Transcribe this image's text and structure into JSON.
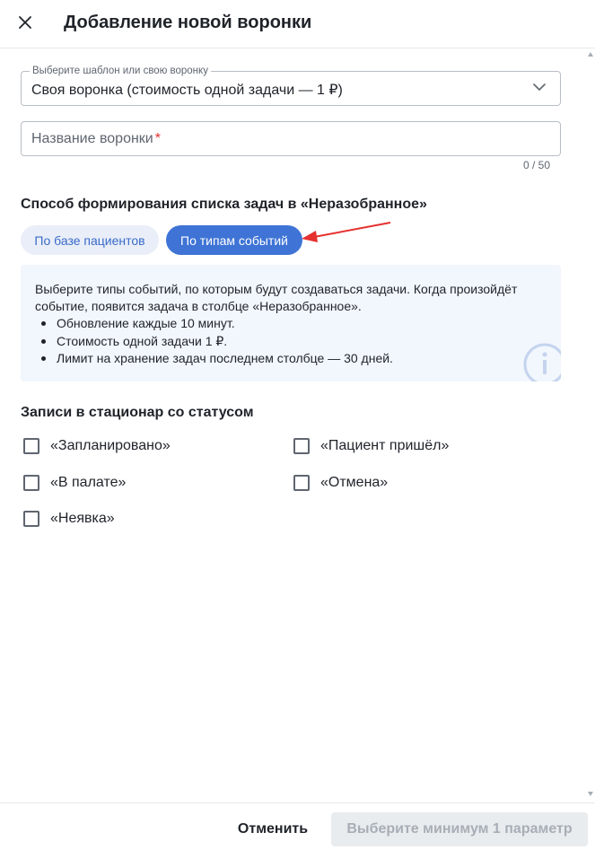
{
  "header": {
    "title": "Добавление новой воронки",
    "close_icon": "close-icon"
  },
  "template_select": {
    "legend": "Выберите шаблон или свою воронку",
    "value": "Своя воронка (стоимость одной задачи — 1 ₽)",
    "icon": "chevron-down-icon"
  },
  "name_input": {
    "placeholder": "Название воронки",
    "required_mark": "*",
    "counter": "0 / 50"
  },
  "method_section": {
    "title": "Способ формирования списка задач в «Неразобранное»",
    "options": [
      {
        "label": "По базе пациентов",
        "selected": false
      },
      {
        "label": "По типам событий",
        "selected": true
      }
    ]
  },
  "info_box": {
    "text": "Выберите типы событий, по которым будут создаваться задачи. Когда произойдёт событие, появится задача в столбце «Неразобранное».",
    "items": [
      "Обновление каждые 10 минут.",
      "Стоимость одной задачи 1 ₽.",
      "Лимит на хранение задач последнем столбце — 30 дней."
    ],
    "icon": "info-icon"
  },
  "status_section": {
    "title": "Записи в стационар со статусом",
    "checkboxes": [
      {
        "label": "«Запланировано»",
        "checked": false
      },
      {
        "label": "«Пациент пришёл»",
        "checked": false
      },
      {
        "label": "«В палате»",
        "checked": false
      },
      {
        "label": "«Отмена»",
        "checked": false
      },
      {
        "label": "«Неявка»",
        "checked": false
      }
    ]
  },
  "footer": {
    "cancel_label": "Отменить",
    "submit_label": "Выберите минимум 1 параметр"
  },
  "colors": {
    "accent": "#3f74d6",
    "chip_inactive_bg": "#e9eef8",
    "info_bg": "#f2f6fd",
    "annotation_arrow": "#e5312f",
    "required": "#e5312f"
  }
}
